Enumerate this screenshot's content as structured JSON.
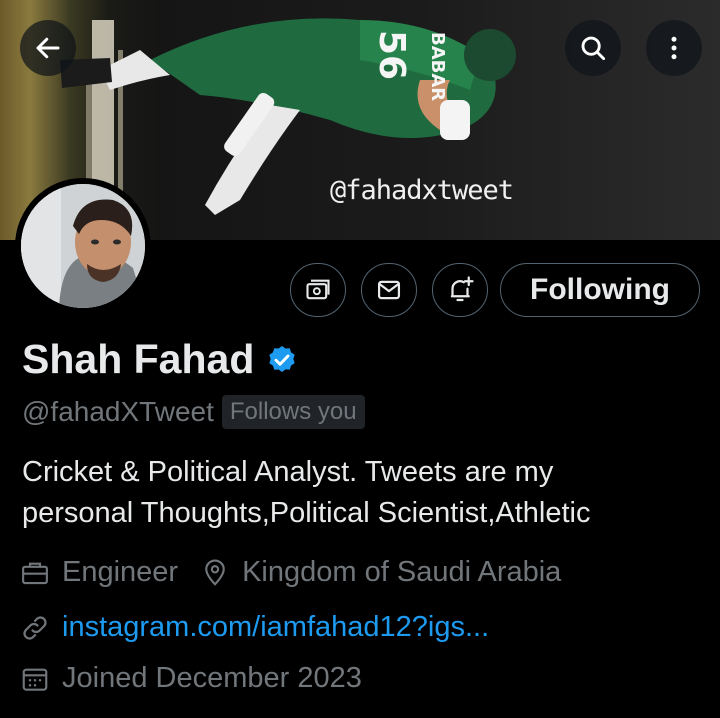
{
  "banner": {
    "watermark": "@fahadxtweet",
    "jersey_name": "BABAR",
    "jersey_number": "56"
  },
  "nav": {
    "back_icon": "arrow-left-icon",
    "search_icon": "search-icon",
    "more_icon": "more-vertical-icon"
  },
  "profile": {
    "name": "Shah Fahad",
    "handle": "@fahadXTweet",
    "follows_you": "Follows you",
    "bio_line1": "Cricket & Political Analyst. Tweets are my",
    "bio_line2": "personal Thoughts,Political Scientist,Athletic",
    "profession": "Engineer",
    "location": "Kingdom of Saudi Arabia",
    "website": "instagram.com/iamfahad12?igs...",
    "joined": "Joined December 2023"
  },
  "actions": {
    "following_label": "Following"
  },
  "colors": {
    "background": "#000000",
    "text": "#e7e9ea",
    "muted": "#71767b",
    "link": "#1d9bf0",
    "verified": "#1d9bf0",
    "border": "#536471"
  }
}
